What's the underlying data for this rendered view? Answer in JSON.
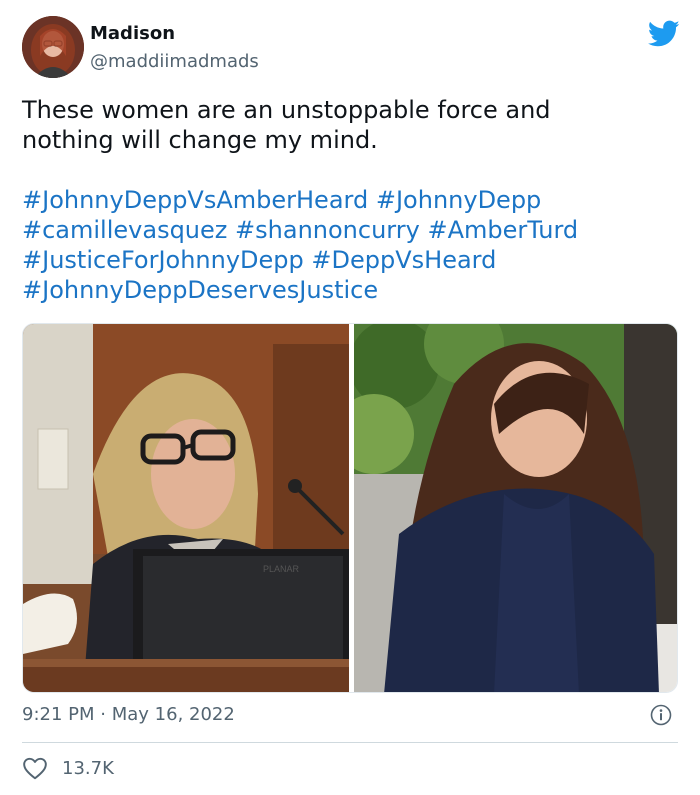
{
  "user": {
    "name": "Madison",
    "handle": "@maddiimadmads"
  },
  "tweet": {
    "text_lines": [
      "These women are an unstoppable force and",
      "nothing will change my mind."
    ],
    "hashtag_lines": [
      [
        "#JohnnyDeppVsAmberHeard",
        "#JohnnyDepp"
      ],
      [
        "#camillevasquez",
        "#shannoncurry",
        "#AmberTurd"
      ],
      [
        "#JusticeForJohnnyDepp",
        "#DeppVsHeard"
      ],
      [
        "#JohnnyDeppDeservesJustice"
      ]
    ]
  },
  "media": {
    "left_monitor_label": "PLANAR"
  },
  "meta": {
    "time": "9:21 PM",
    "separator": "·",
    "date": "May 16, 2022"
  },
  "engagement": {
    "likes": "13.7K"
  },
  "colors": {
    "link": "#1b74c5",
    "twitter_blue": "#1d9bf0",
    "secondary_text": "#536471"
  }
}
